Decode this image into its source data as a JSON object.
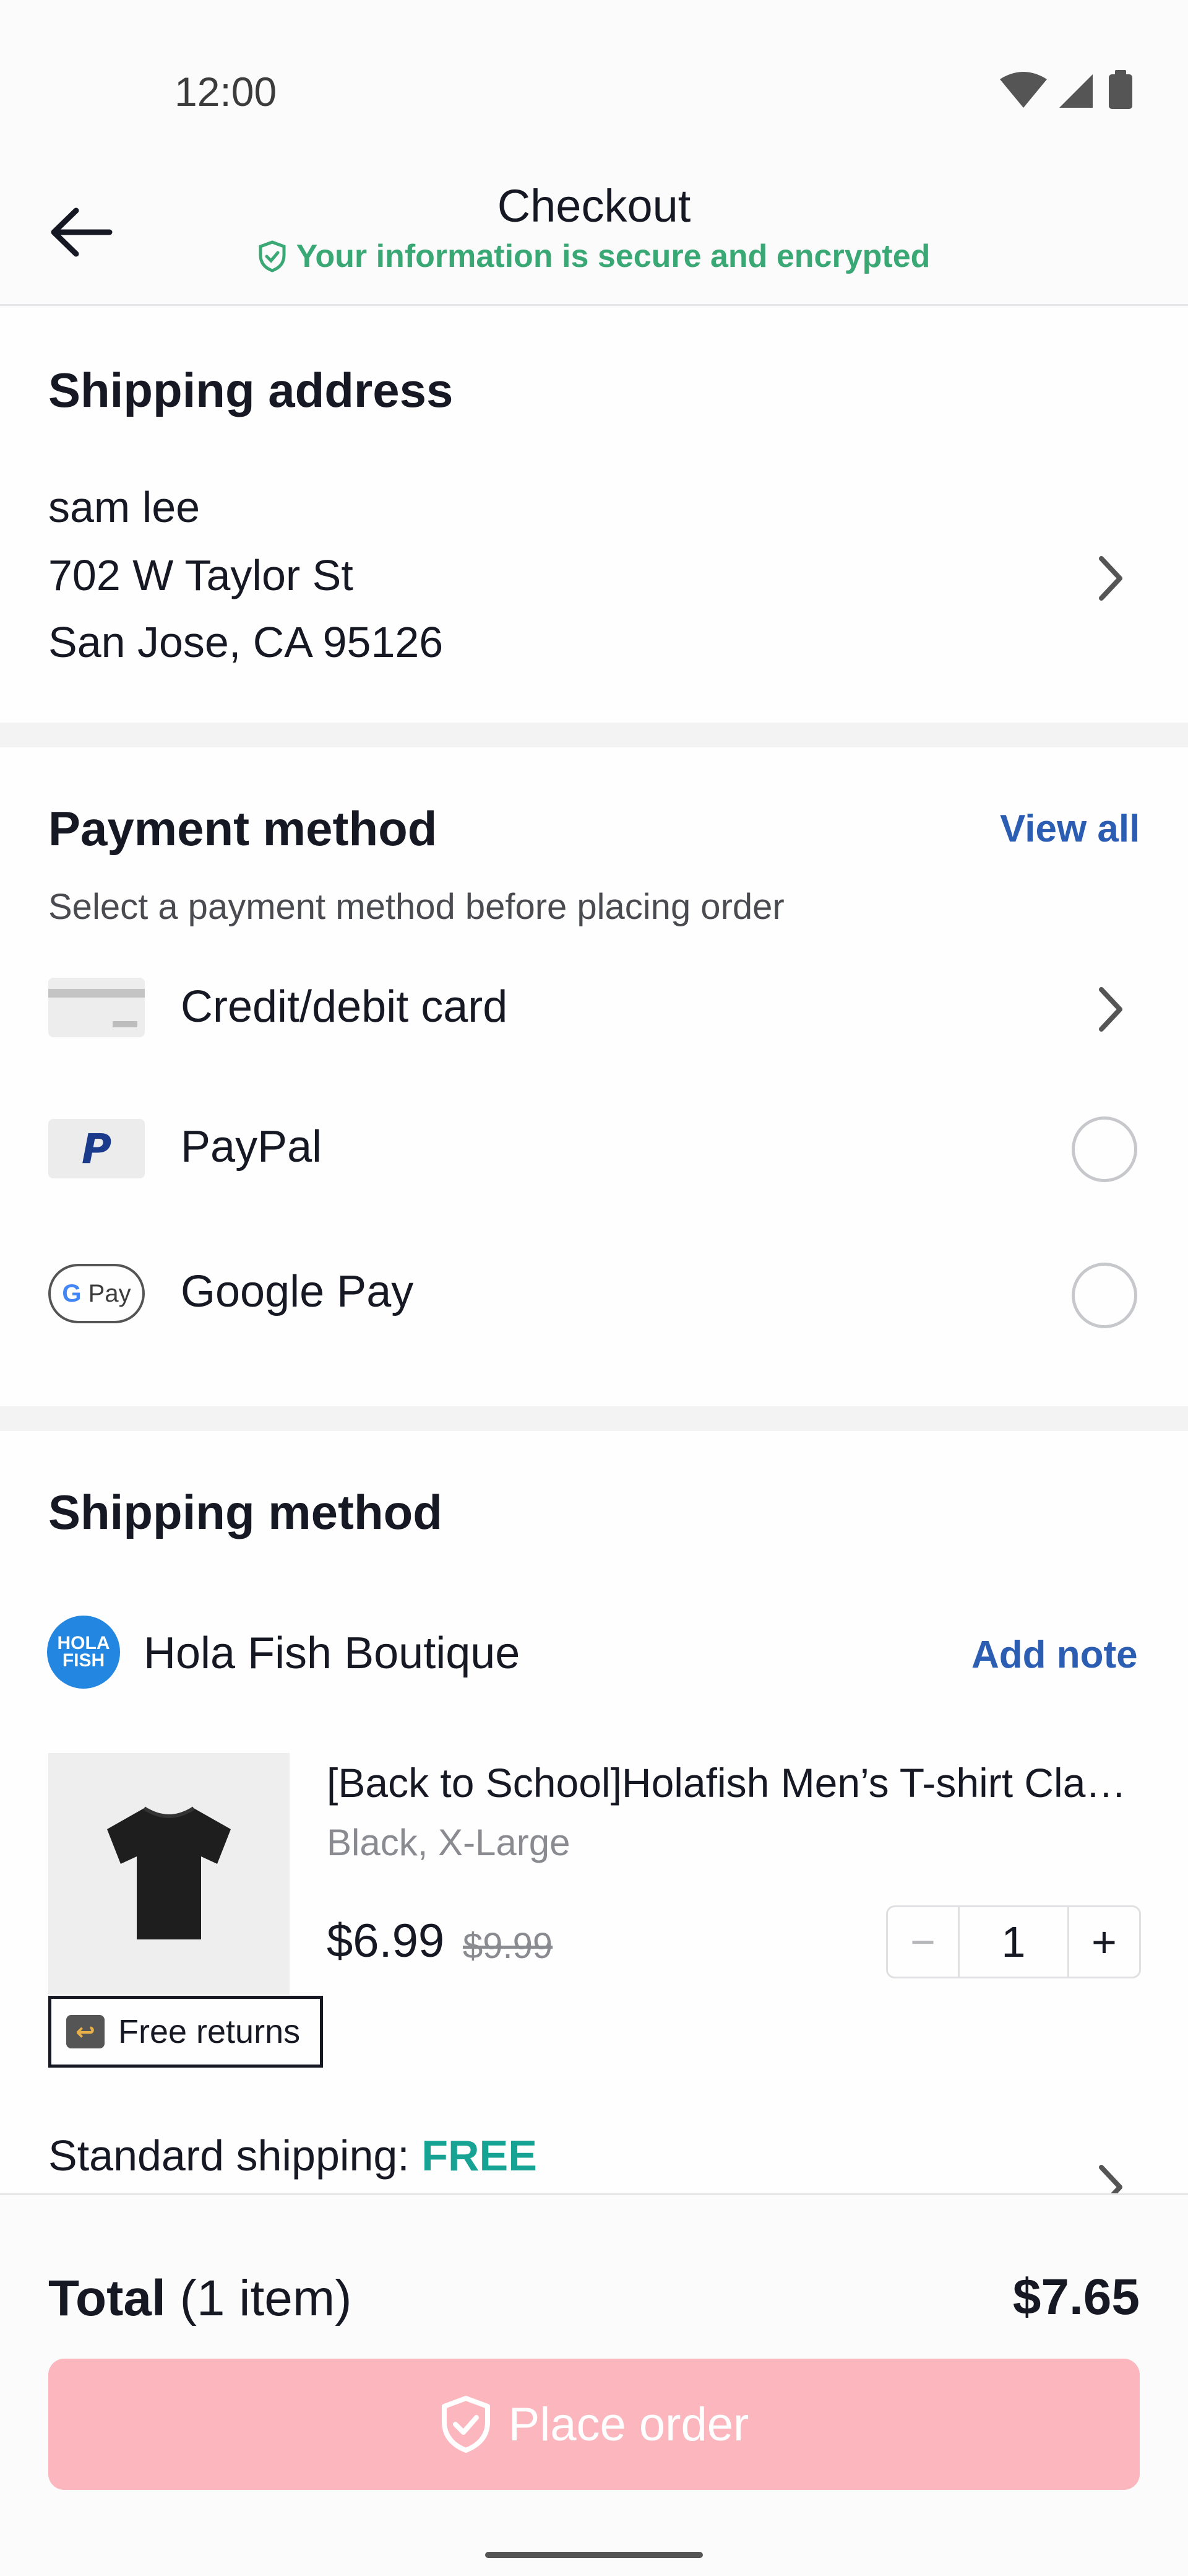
{
  "status": {
    "time": "12:00"
  },
  "header": {
    "title": "Checkout",
    "secure_text": "Your information is secure and encrypted"
  },
  "shipping_address": {
    "title": "Shipping address",
    "name": "sam lee",
    "street": "702 W Taylor St",
    "city_line": "San Jose, CA 95126"
  },
  "payment": {
    "title": "Payment method",
    "view_all": "View all",
    "hint": "Select a payment method before placing order",
    "options": [
      {
        "label": "Credit/debit card",
        "icon": "credit-card-icon"
      },
      {
        "label": "PayPal",
        "icon": "paypal-icon"
      },
      {
        "label": "Google Pay",
        "icon": "google-pay-icon"
      }
    ]
  },
  "shipping_method": {
    "title": "Shipping method",
    "store_name": "Hola Fish Boutique",
    "store_logo_text": "HOLA FISH",
    "add_note": "Add note",
    "product": {
      "title": "[Back to School]Holafish Men’s T-shirt Classic Crew Neck Short Sleeve",
      "variant": "Black, X-Large",
      "price": "$6.99",
      "original_price": "$9.99",
      "quantity": "1"
    },
    "badge": "Free returns",
    "shipping_label": "Standard shipping:",
    "shipping_value": "FREE"
  },
  "footer": {
    "total_label": "Total",
    "item_count": "(1 item)",
    "total_value": "$7.65",
    "place_order": "Place order"
  },
  "colors": {
    "secure_green": "#3aa875",
    "link_blue": "#2b5db3",
    "free_teal": "#16a394",
    "place_order_disabled": "#fcb6be"
  }
}
